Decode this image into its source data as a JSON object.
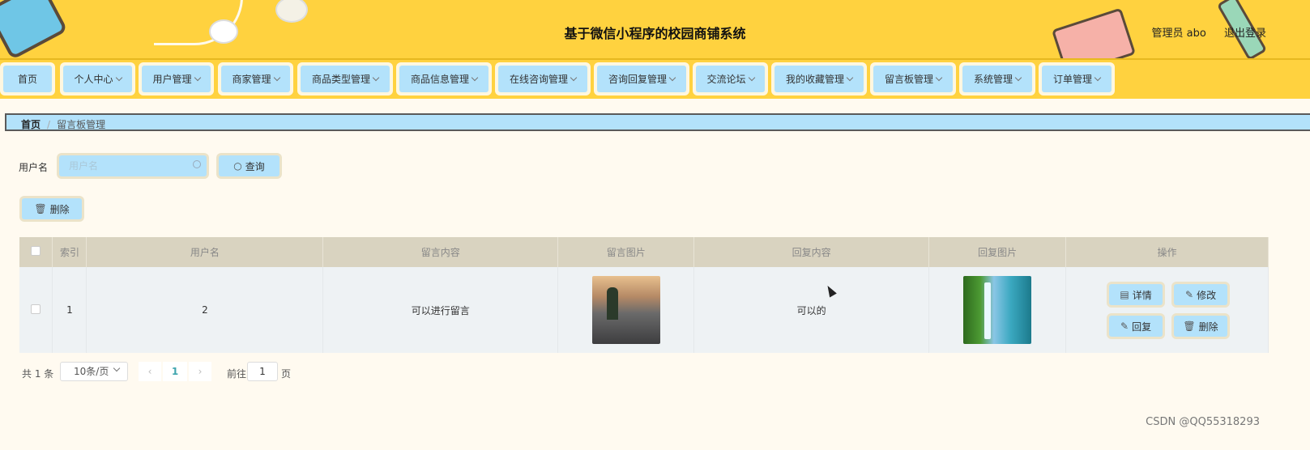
{
  "header": {
    "title": "基于微信小程序的校园商铺系统",
    "user": "管理员 abo",
    "logout": "退出登录"
  },
  "nav": [
    "首页",
    "个人中心",
    "用户管理",
    "商家管理",
    "商品类型管理",
    "商品信息管理",
    "在线咨询管理",
    "咨询回复管理",
    "交流论坛",
    "我的收藏管理",
    "留言板管理",
    "系统管理",
    "订单管理"
  ],
  "breadcrumb": {
    "home": "首页",
    "sep": "/",
    "current": "留言板管理"
  },
  "search": {
    "label": "用户名",
    "placeholder": "用户名",
    "button": "查询"
  },
  "toolbar": {
    "delete": "删除"
  },
  "table": {
    "headers": [
      "索引",
      "用户名",
      "留言内容",
      "留言图片",
      "回复内容",
      "回复图片",
      "操作"
    ],
    "rows": [
      {
        "index": "1",
        "username": "2",
        "content": "可以进行留言",
        "reply": "可以的"
      }
    ],
    "actions": {
      "detail": "详情",
      "edit": "修改",
      "reply": "回复",
      "delete": "删除"
    }
  },
  "pager": {
    "total": "共 1 条",
    "size": "10条/页",
    "current": "1",
    "goto": "前往",
    "goto_value": "1",
    "unit": "页"
  },
  "watermark": "CSDN @QQ55318293",
  "colors": {
    "header_bg": "#ffd23f",
    "button_bg": "#b3e2fb",
    "button_frame": "#ebe3c9",
    "page_bg": "#fffaf0"
  }
}
